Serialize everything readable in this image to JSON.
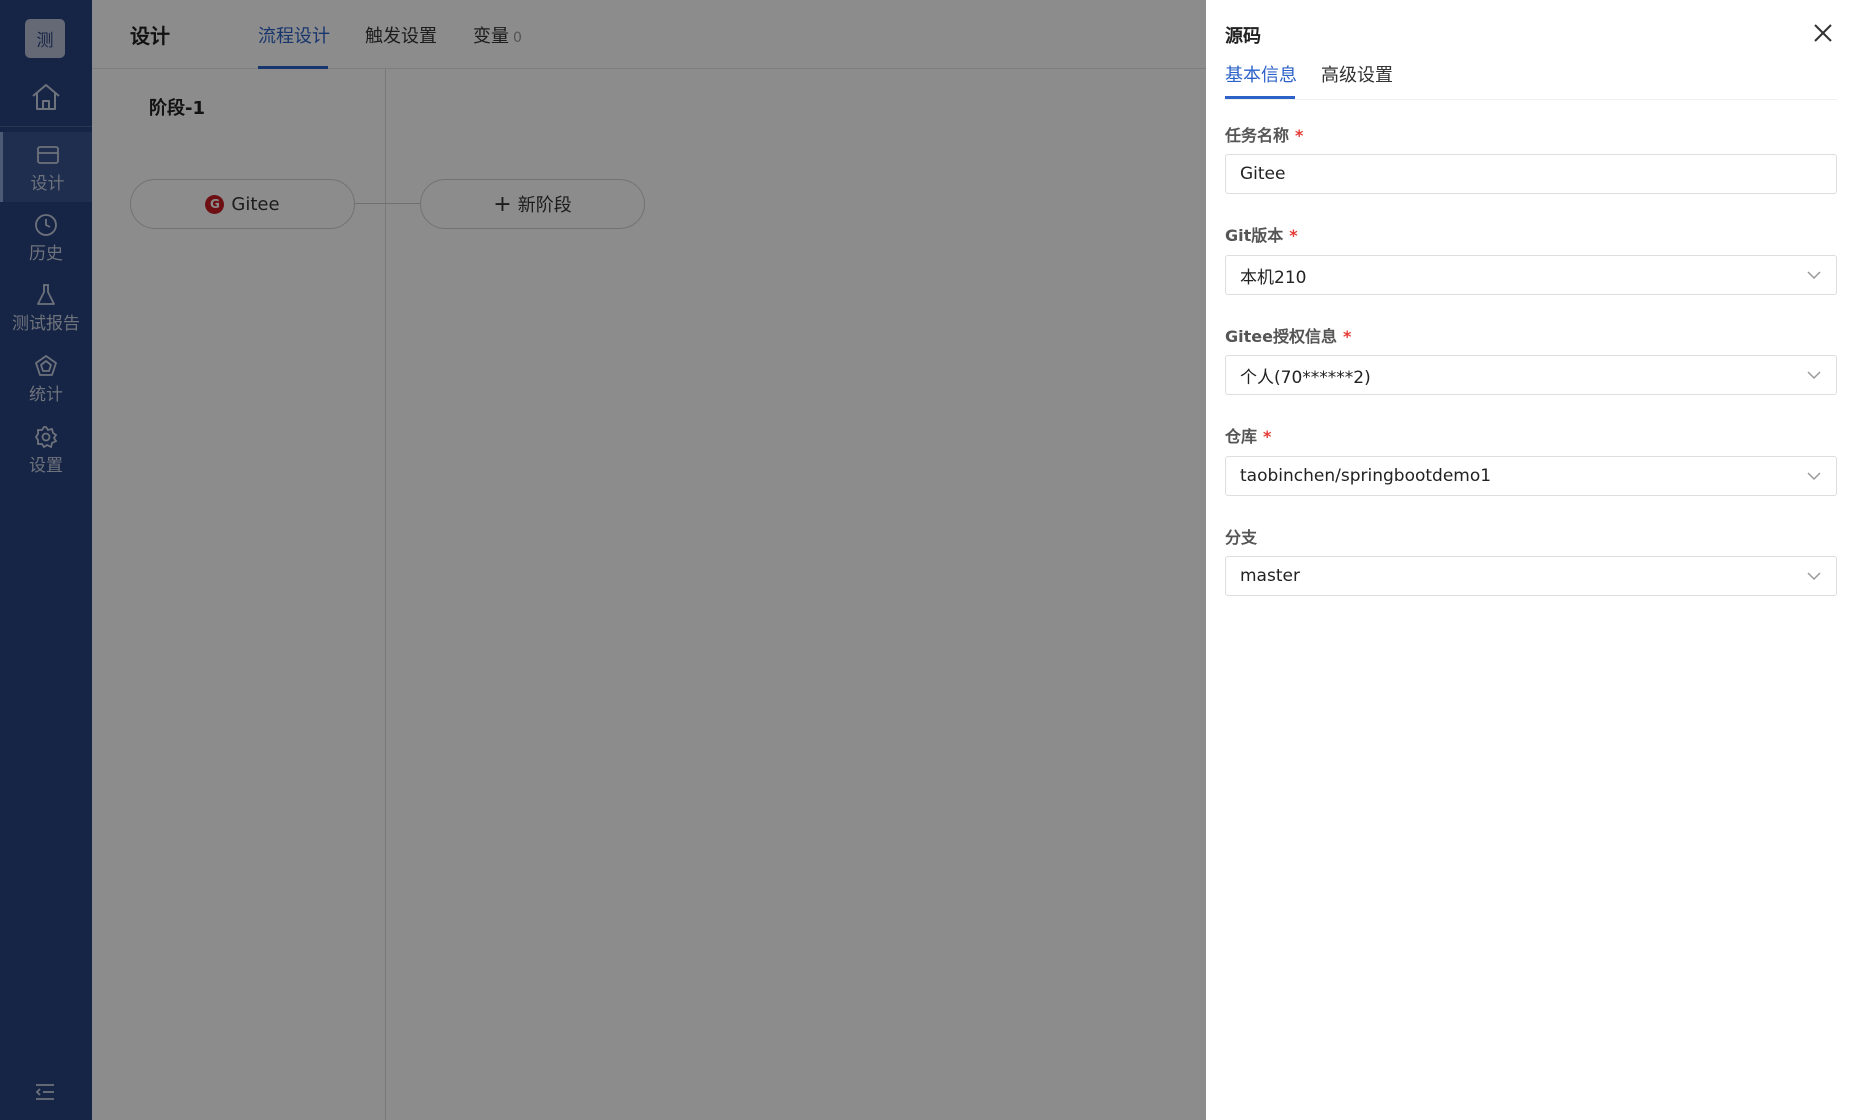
{
  "app": {
    "logo_text": "测"
  },
  "sidebar": {
    "items": [
      {
        "label": "设计",
        "icon": "card-icon"
      },
      {
        "label": "历史",
        "icon": "clock-icon"
      },
      {
        "label": "测试报告",
        "icon": "flask-icon"
      },
      {
        "label": "统计",
        "icon": "pentagon-icon"
      },
      {
        "label": "设置",
        "icon": "gear-icon"
      }
    ]
  },
  "header": {
    "title": "设计",
    "tabs": [
      {
        "label": "流程设计"
      },
      {
        "label": "触发设置"
      },
      {
        "label": "变量",
        "count": "0"
      }
    ]
  },
  "pipeline": {
    "stage_title": "阶段-1",
    "task_label": "Gitee",
    "new_stage_label": "新阶段"
  },
  "drawer": {
    "title": "源码",
    "tabs": [
      {
        "label": "基本信息"
      },
      {
        "label": "高级设置"
      }
    ],
    "fields": {
      "task_name": {
        "label": "任务名称",
        "value": "Gitee",
        "required": "*"
      },
      "git_version": {
        "label": "Git版本",
        "value": "本机210",
        "required": "*"
      },
      "auth": {
        "label": "Gitee授权信息",
        "value": "个人(70******2)",
        "required": "*"
      },
      "repo": {
        "label": "仓库",
        "value": "taobinchen/springbootdemo1",
        "required": "*"
      },
      "branch": {
        "label": "分支",
        "value": "master"
      }
    }
  },
  "colors": {
    "sidebar": "#29437f",
    "accent": "#2d63c8",
    "required": "#e53935",
    "gitee": "#c71d23"
  }
}
